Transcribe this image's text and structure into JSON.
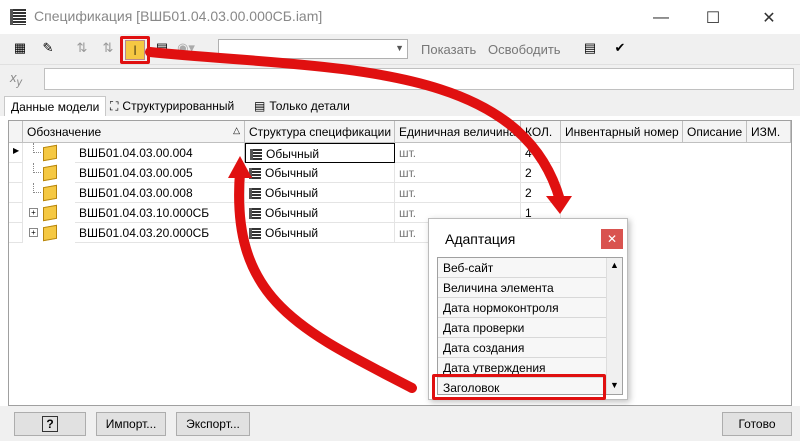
{
  "window": {
    "title": "Спецификация [ВШБ01.04.03.00.000СБ.iam]",
    "minimize": "—",
    "maximize": "☐",
    "close": "✕"
  },
  "toolbar": {
    "show_label": "Показать",
    "release_label": "Освободить",
    "dropdown_value": ""
  },
  "formula": {
    "icon": "fx-icon",
    "value": ""
  },
  "tabs": [
    {
      "label": "Данные модели"
    },
    {
      "label": "Структурированный"
    },
    {
      "label": "Только детали"
    }
  ],
  "table": {
    "columns": [
      "Обозначение",
      "Структура спецификации",
      "Единичная величина",
      "КОЛ.",
      "Инвентарный номер",
      "Описание",
      "ИЗМ."
    ],
    "rows": [
      {
        "designation": "ВШБ01.04.03.00.004",
        "structure": "Обычный",
        "unit": "шт.",
        "qty": "4"
      },
      {
        "designation": "ВШБ01.04.03.00.005",
        "structure": "Обычный",
        "unit": "шт.",
        "qty": "2"
      },
      {
        "designation": "ВШБ01.04.03.00.008",
        "structure": "Обычный",
        "unit": "шт.",
        "qty": "2"
      },
      {
        "designation": "ВШБ01.04.03.10.000СБ",
        "structure": "Обычный",
        "unit": "шт.",
        "qty": "1"
      },
      {
        "designation": "ВШБ01.04.03.20.000СБ",
        "structure": "Обычный",
        "unit": "шт.",
        "qty": ""
      }
    ]
  },
  "popup": {
    "title": "Адаптация",
    "items": [
      "Веб-сайт",
      "Величина элемента",
      "Дата нормоконтроля",
      "Дата проверки",
      "Дата создания",
      "Дата утверждения",
      "Заголовок"
    ]
  },
  "bottom": {
    "help_label": "?",
    "import_label": "Импорт...",
    "export_label": "Экспорт...",
    "done_label": "Готово"
  },
  "colors": {
    "annotation_red": "#e01010",
    "cube_yellow": "#f5c842"
  }
}
